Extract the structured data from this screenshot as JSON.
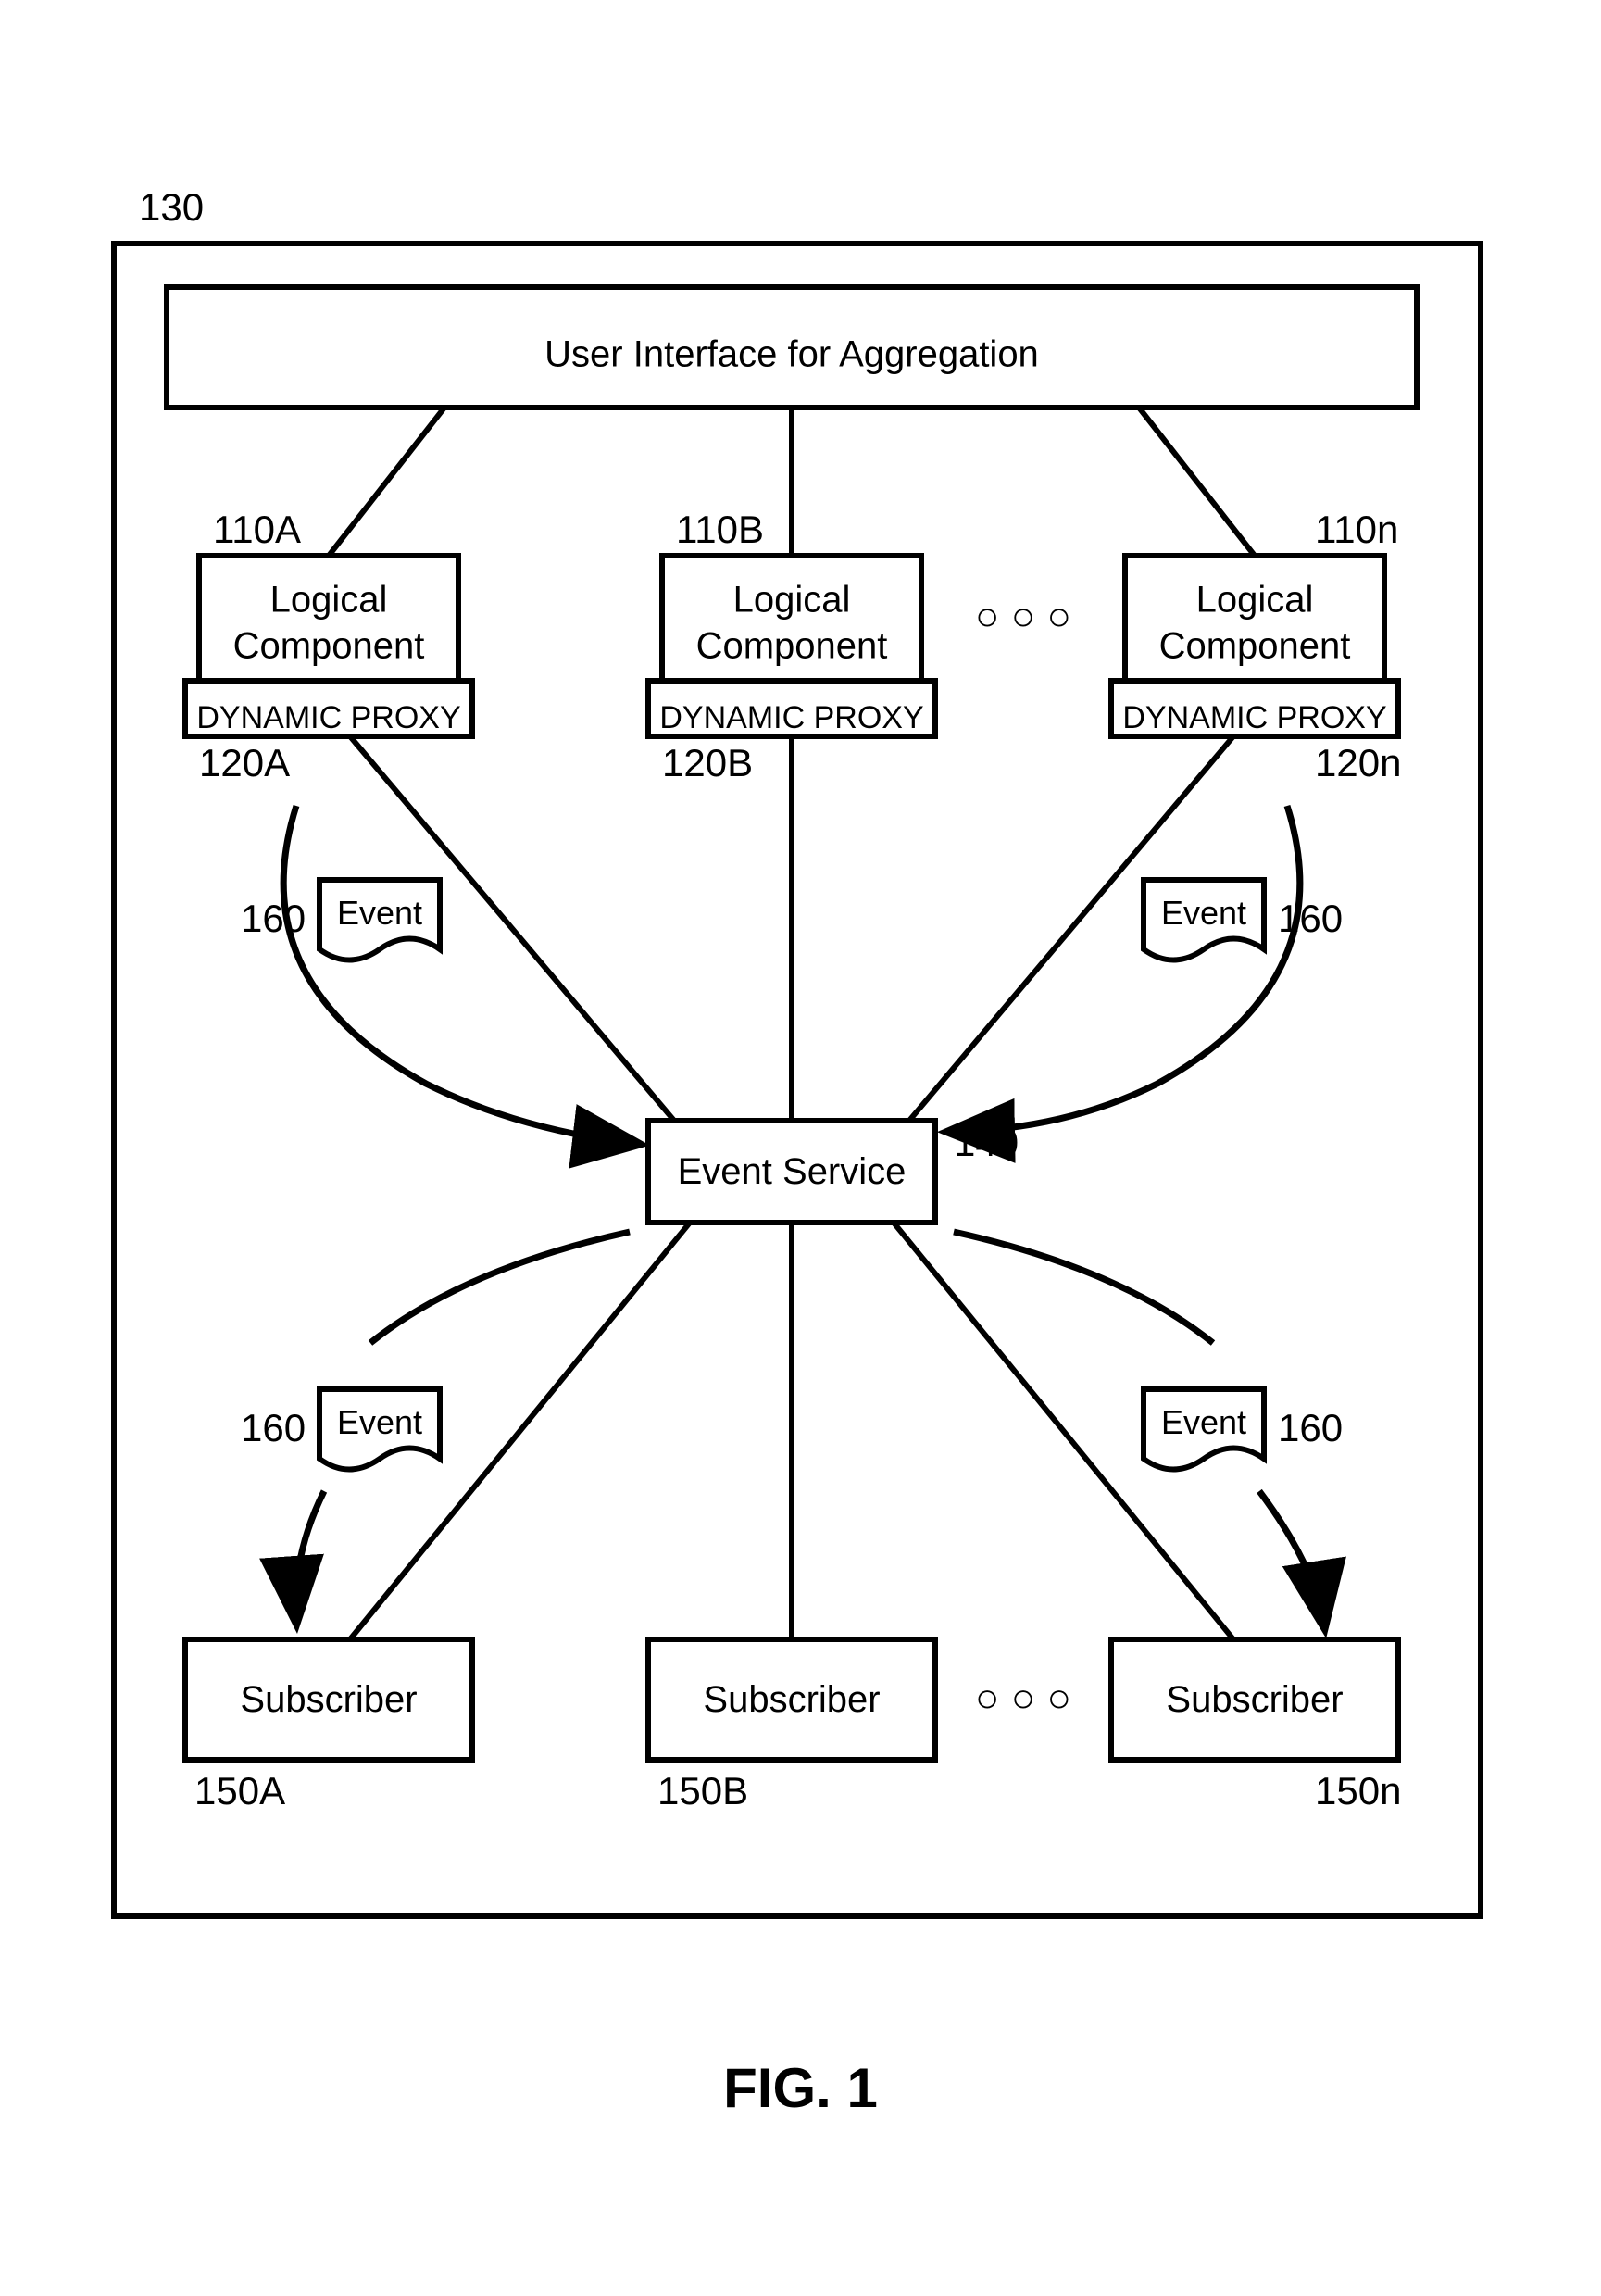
{
  "figure_label": "FIG. 1",
  "outer_ref": "130",
  "ui_box": {
    "label": "User Interface for Aggregation"
  },
  "components": [
    {
      "ref": "110A",
      "proxy_ref": "120A",
      "top": "Logical",
      "bottom": "Component",
      "proxy": "DYNAMIC PROXY"
    },
    {
      "ref": "110B",
      "proxy_ref": "120B",
      "top": "Logical",
      "bottom": "Component",
      "proxy": "DYNAMIC PROXY"
    },
    {
      "ref": "110n",
      "proxy_ref": "120n",
      "top": "Logical",
      "bottom": "Component",
      "proxy": "DYNAMIC PROXY"
    }
  ],
  "ellipsis": "○ ○ ○",
  "events": {
    "label": "Event",
    "ref": "160"
  },
  "event_service": {
    "label": "Event Service",
    "ref": "140"
  },
  "subscribers": [
    {
      "ref": "150A",
      "label": "Subscriber"
    },
    {
      "ref": "150B",
      "label": "Subscriber"
    },
    {
      "ref": "150n",
      "label": "Subscriber"
    }
  ]
}
